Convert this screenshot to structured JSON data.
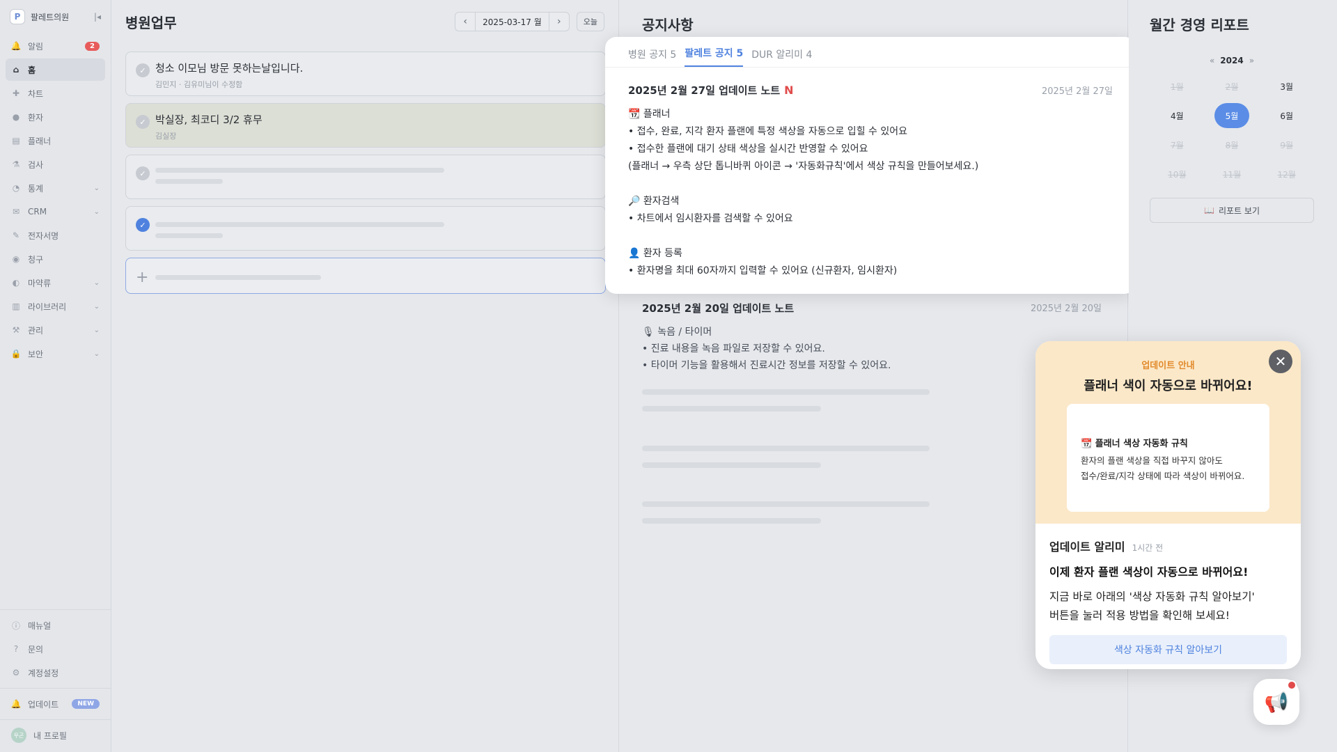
{
  "sidebar": {
    "brand": "팔레트의원",
    "items": [
      {
        "label": "알림",
        "badge": "2",
        "icon": "bell-icon"
      },
      {
        "label": "홈",
        "icon": "home-icon",
        "active": true
      },
      {
        "label": "차트",
        "icon": "plus-icon"
      },
      {
        "label": "환자",
        "icon": "person-icon"
      },
      {
        "label": "플래너",
        "icon": "calendar-icon"
      },
      {
        "label": "검사",
        "icon": "flask-icon"
      },
      {
        "label": "통계",
        "icon": "pie-icon",
        "expandable": true
      },
      {
        "label": "CRM",
        "icon": "mail-icon",
        "expandable": true
      },
      {
        "label": "전자서명",
        "icon": "sign-icon"
      },
      {
        "label": "청구",
        "icon": "claim-icon"
      },
      {
        "label": "마약류",
        "icon": "pill-icon",
        "expandable": true
      },
      {
        "label": "라이브러리",
        "icon": "library-icon",
        "expandable": true
      },
      {
        "label": "관리",
        "icon": "wrench-icon",
        "expandable": true
      },
      {
        "label": "보안",
        "icon": "lock-icon",
        "expandable": true
      }
    ],
    "bottom": {
      "manual": "매뉴얼",
      "inquiry": "문의",
      "account": "계정설정",
      "update": "업데이트",
      "update_badge": "NEW",
      "profile": "내 프로필",
      "avatar_text": "우곤"
    }
  },
  "work": {
    "title": "병원업무",
    "date": "2025-03-17 월",
    "today": "오늘",
    "tasks": [
      {
        "title": "청소 이모님 방문 못하는날입니다.",
        "sub": "김민지 · 김유미님이 수정함"
      },
      {
        "title": "박실장, 최코디 3/2 휴무",
        "sub": "김실장"
      }
    ]
  },
  "notice": {
    "title": "공지사항",
    "tabs": [
      "병원 공지 5",
      "팔레트 공지 5",
      "DUR 알리미 4"
    ],
    "active_tab": 1,
    "card": {
      "title": "2025년 2월 27일 업데이트 노트",
      "new_mark": "N",
      "date": "2025년 2월 27일",
      "lines": [
        "📆 플래너",
        "• 접수, 완료, 지각 환자 플랜에 특정 색상을 자동으로 입힐 수 있어요",
        "• 접수한 플랜에 대기 상태 색상을 실시간 반영할 수 있어요",
        "(플래너 → 우측 상단 톱니바퀴 아이콘 → '자동화규칙'에서 색상 규칙을 만들어보세요.)",
        "",
        "🔎 환자검색",
        "• 차트에서 임시환자를 검색할 수 있어요",
        "",
        "👤 환자 등록",
        "• 환자명을 최대 60자까지 입력할 수 있어요 (신규환자, 임시환자)"
      ]
    },
    "second": {
      "title": "2025년 2월 20일 업데이트 노트",
      "date": "2025년 2월 20일",
      "lines": [
        "🎙 녹음 / 타이머",
        "• 진료 내용을 녹음 파일로 저장할 수 있어요.",
        "• 타이머 기능을 활용해서 진료시간 정보를 저장할 수 있어요."
      ]
    }
  },
  "report": {
    "title": "월간 경영 리포트",
    "year": "2024",
    "prev": "«",
    "next": "»",
    "months": [
      "1월",
      "2월",
      "3월",
      "4월",
      "5월",
      "6월",
      "7월",
      "8월",
      "9월",
      "10월",
      "11월",
      "12월"
    ],
    "enabled": [
      2,
      3,
      4,
      5
    ],
    "selected": 4,
    "button": "리포트 보기"
  },
  "popup": {
    "kicker": "업데이트 안내",
    "headline": "플래너 색이 자동으로 바뀌어요!",
    "inner_title": "📆 플래너 색상 자동화 규칙",
    "inner_text1": "환자의 플랜 색상을 직접 바꾸지 않아도",
    "inner_text2": "접수/완료/지각 상태에 따라 색상이 바뀌어요.",
    "sender": "업데이트 알리미",
    "time": "1시간 전",
    "strong": "이제 환자 플랜 색상이 자동으로 바뀌어요!",
    "text1": "지금 바로 아래의 '색상 자동화 규칙 알아보기'",
    "text2": "버튼을 눌러 적용 방법을 확인해 보세요!",
    "button": "색상 자동화 규칙 알아보기"
  }
}
